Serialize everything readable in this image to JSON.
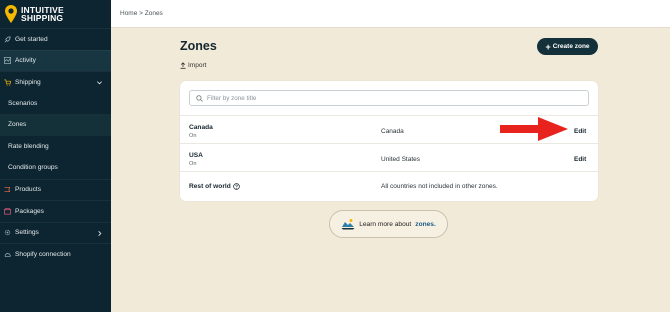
{
  "brand": {
    "name": "INTUITIVE\nSHIPPING",
    "accent": "#f5b800"
  },
  "sidebar": {
    "items": [
      {
        "label": "Get started",
        "icon": "rocket-icon"
      },
      {
        "label": "Activity",
        "icon": "activity-icon"
      },
      {
        "label": "Shipping",
        "icon": "cart-icon",
        "expanded": true
      },
      {
        "label": "Scenarios"
      },
      {
        "label": "Zones"
      },
      {
        "label": "Rate blending"
      },
      {
        "label": "Condition groups"
      },
      {
        "label": "Products",
        "icon": "tag-icon"
      },
      {
        "label": "Packages",
        "icon": "box-icon"
      },
      {
        "label": "Settings",
        "icon": "gear-icon"
      },
      {
        "label": "Shopify connection",
        "icon": "cloud-icon"
      }
    ]
  },
  "breadcrumb": "Home > Zones",
  "page": {
    "title": "Zones",
    "import_label": "Import",
    "create_button": "Create zone"
  },
  "search": {
    "placeholder": "Filter by zone title",
    "value": ""
  },
  "zones": [
    {
      "name": "Canada",
      "status": "On",
      "region": "Canada",
      "action": "Edit"
    },
    {
      "name": "USA",
      "status": "On",
      "region": "United States",
      "action": "Edit"
    },
    {
      "name": "Rest of world",
      "status": "",
      "region": "All countries not included in other zones.",
      "action": ""
    }
  ],
  "learn_more": {
    "prefix": "Learn more about",
    "keyword": "zones."
  },
  "colors": {
    "sidebar_bg": "#0d2530",
    "page_bg": "#f2ead9",
    "arrow": "#e8231d",
    "link": "#1a5d84"
  }
}
